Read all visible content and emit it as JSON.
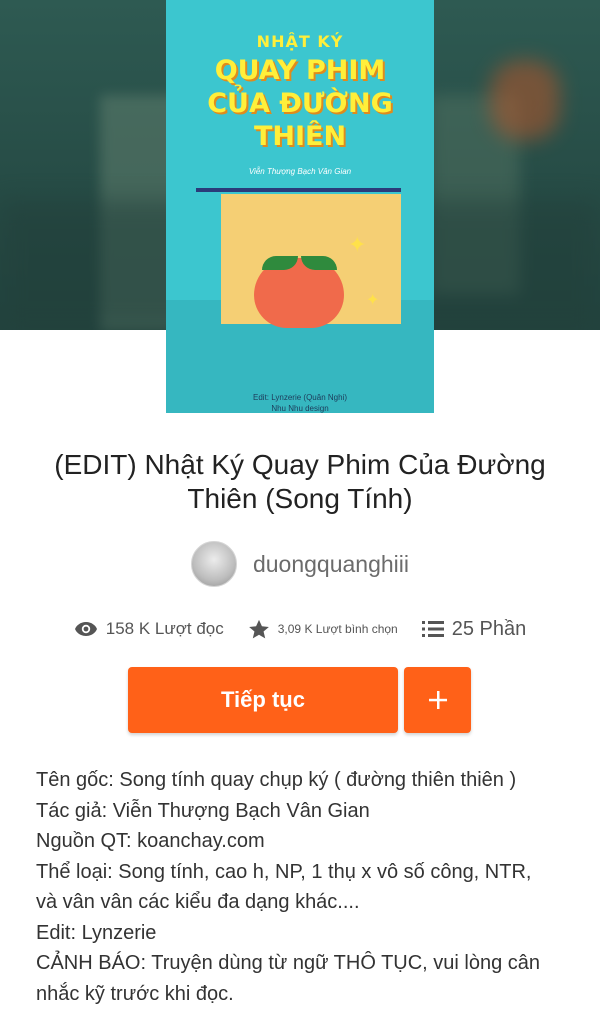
{
  "cover": {
    "top_text": "NHẬT KÝ",
    "title_lines": [
      "QUAY PHIM",
      "CỦA ĐƯỜNG",
      "THIÊN"
    ],
    "author": "Viễn Thượng Bạch Vân Gian",
    "credits": [
      "Edit: Lynzerie (Quân Nghi)",
      "Nhu Nhu design"
    ],
    "colors": {
      "background": "#3cc6cf",
      "title": "#ffef3a",
      "peach": "#f06a4b"
    }
  },
  "story": {
    "title": "(EDIT) Nhật Ký Quay Phim Của Đường Thiên (Song Tính)",
    "author_username": "duongquanghiii"
  },
  "stats": {
    "views": "158 K Lượt đọc",
    "votes": "3,09 K Lượt bình chọn",
    "parts": "25 Phần",
    "icons": [
      "eye-icon",
      "star-icon",
      "list-icon"
    ]
  },
  "actions": {
    "continue_label": "Tiếp tục",
    "add_label": "+",
    "accent_color": "#ff6118"
  },
  "description": [
    "Tên gốc: Song tính quay chụp ký ( đường thiên thiên )",
    "Tác giả: Viễn Thượng Bạch Vân Gian",
    "Nguồn QT: koanchay.com",
    "Thể loại: Song tính, cao h, NP, 1 thụ x vô số công, NTR,",
    "và vân vân các kiểu đa dạng khác....",
    "Edit: Lynzerie",
    "CẢNH BÁO: Truyện dùng từ ngữ  THÔ TỤC, vui lòng cân",
    "nhắc kỹ trước khi đọc."
  ]
}
